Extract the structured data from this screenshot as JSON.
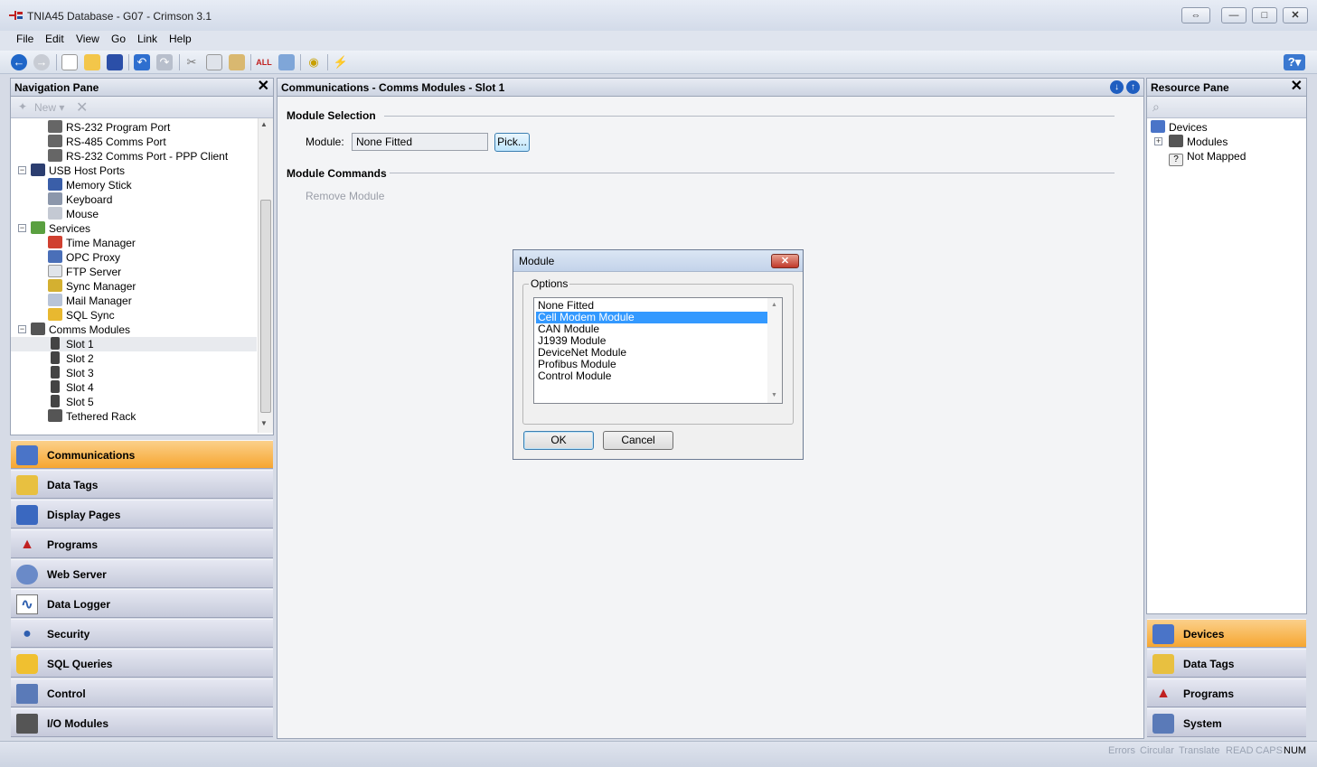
{
  "window": {
    "title": "TNIA45 Database - G07 - Crimson 3.1"
  },
  "menu": [
    "File",
    "Edit",
    "View",
    "Go",
    "Link",
    "Help"
  ],
  "nav_pane": {
    "title": "Navigation Pane",
    "new_label": "New",
    "items": [
      {
        "label": "RS-232 Program Port"
      },
      {
        "label": "RS-485 Comms Port"
      },
      {
        "label": "RS-232 Comms Port - PPP Client"
      },
      {
        "label": "USB Host Ports"
      },
      {
        "label": "Memory Stick"
      },
      {
        "label": "Keyboard"
      },
      {
        "label": "Mouse"
      },
      {
        "label": "Services"
      },
      {
        "label": "Time Manager"
      },
      {
        "label": "OPC Proxy"
      },
      {
        "label": "FTP Server"
      },
      {
        "label": "Sync Manager"
      },
      {
        "label": "Mail Manager"
      },
      {
        "label": "SQL Sync"
      },
      {
        "label": "Comms Modules"
      },
      {
        "label": "Slot 1"
      },
      {
        "label": "Slot 2"
      },
      {
        "label": "Slot 3"
      },
      {
        "label": "Slot 4"
      },
      {
        "label": "Slot 5"
      },
      {
        "label": "Tethered Rack"
      }
    ],
    "categories": [
      {
        "label": "Communications"
      },
      {
        "label": "Data Tags"
      },
      {
        "label": "Display Pages"
      },
      {
        "label": "Programs"
      },
      {
        "label": "Web Server"
      },
      {
        "label": "Data Logger"
      },
      {
        "label": "Security"
      },
      {
        "label": "SQL Queries"
      },
      {
        "label": "Control"
      },
      {
        "label": "I/O Modules"
      }
    ]
  },
  "main": {
    "title": "Communications - Comms Modules - Slot 1",
    "module_selection_header": "Module Selection",
    "module_label": "Module:",
    "module_value": "None Fitted",
    "pick_button": "Pick...",
    "module_commands_header": "Module Commands",
    "remove_module": "Remove Module"
  },
  "dialog": {
    "title": "Module",
    "options_label": "Options",
    "options": [
      "None Fitted",
      "Cell Modem Module",
      "CAN Module",
      "J1939 Module",
      "DeviceNet Module",
      "Profibus Module",
      "Control Module"
    ],
    "selected_index": 1,
    "ok": "OK",
    "cancel": "Cancel"
  },
  "resource_pane": {
    "title": "Resource Pane",
    "tree": [
      {
        "label": "Devices"
      },
      {
        "label": "Modules"
      },
      {
        "label": "Not Mapped"
      }
    ],
    "categories": [
      {
        "label": "Devices"
      },
      {
        "label": "Data Tags"
      },
      {
        "label": "Programs"
      },
      {
        "label": "System"
      }
    ]
  },
  "status": [
    "Errors",
    "Circular",
    "Translate",
    "READ",
    "CAPS",
    "NUM"
  ],
  "colors": {
    "active_category": "#f6a630",
    "selection": "#3399ff"
  }
}
